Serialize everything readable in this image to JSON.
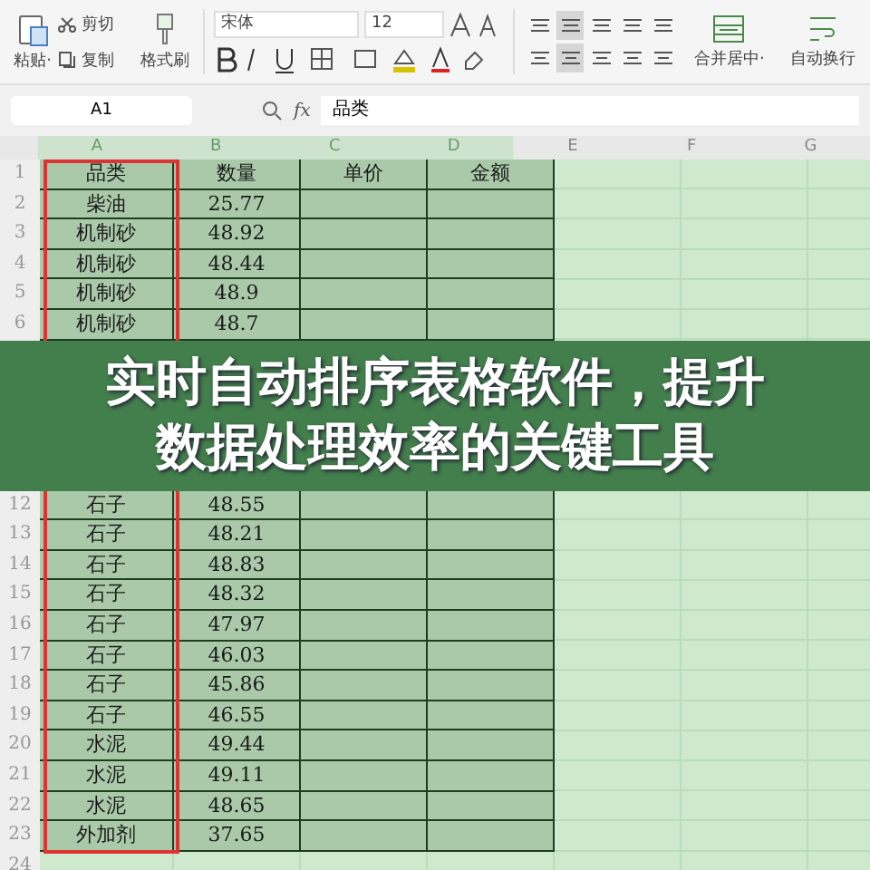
{
  "ribbon": {
    "clipboard": [
      {
        "kind": "paste",
        "label": "粘贴·"
      },
      {
        "kind": "cut",
        "label": "剪切"
      },
      {
        "kind": "copy",
        "label": "复制"
      },
      {
        "kind": "brush",
        "label": "格式刷"
      }
    ],
    "font": {
      "family": "宋体",
      "size": "12"
    },
    "align_selected": [
      false,
      true,
      false,
      false,
      false,
      false,
      true,
      false,
      false,
      false
    ],
    "merge": "合并居中·",
    "wrap": "自动换行"
  },
  "formula_bar": {
    "name_box": "A1",
    "fx": "fx",
    "value": "品类"
  },
  "columns": [
    {
      "label": "A",
      "selected": true
    },
    {
      "label": "B",
      "selected": true
    },
    {
      "label": "C",
      "selected": true
    },
    {
      "label": "D",
      "selected": true
    },
    {
      "label": "E",
      "selected": false
    },
    {
      "label": "F",
      "selected": false
    },
    {
      "label": "G",
      "selected": false
    }
  ],
  "rows_above": [
    {
      "number": "1",
      "cells": [
        "品类",
        "数量",
        "单价",
        "金额"
      ]
    },
    {
      "number": "2",
      "cells": [
        "柴油",
        "25.77"
      ]
    },
    {
      "number": "3",
      "cells": [
        "机制砂",
        "48.92"
      ]
    },
    {
      "number": "4",
      "cells": [
        "机制砂",
        "48.44"
      ]
    },
    {
      "number": "5",
      "cells": [
        "机制砂",
        "48.9"
      ]
    },
    {
      "number": "6",
      "cells": [
        "机制砂",
        "48.7"
      ]
    }
  ],
  "banner": {
    "text": "实时自动排序表格软件，提升数据处理效率的关键工具"
  },
  "rows_below": [
    {
      "number": "12",
      "cells": [
        "石子",
        "48.55"
      ]
    },
    {
      "number": "13",
      "cells": [
        "石子",
        "48.21"
      ]
    },
    {
      "number": "14",
      "cells": [
        "石子",
        "48.83"
      ]
    },
    {
      "number": "15",
      "cells": [
        "石子",
        "48.32"
      ]
    },
    {
      "number": "16",
      "cells": [
        "石子",
        "47.97"
      ]
    },
    {
      "number": "17",
      "cells": [
        "石子",
        "46.03"
      ]
    },
    {
      "number": "18",
      "cells": [
        "石子",
        "45.86"
      ]
    },
    {
      "number": "19",
      "cells": [
        "石子",
        "46.55"
      ]
    },
    {
      "number": "20",
      "cells": [
        "水泥",
        "49.44"
      ]
    },
    {
      "number": "21",
      "cells": [
        "水泥",
        "49.11"
      ]
    },
    {
      "number": "22",
      "cells": [
        "水泥",
        "48.65"
      ]
    },
    {
      "number": "23",
      "cells": [
        "外加剂",
        "37.65"
      ]
    },
    {
      "number": "24"
    }
  ]
}
